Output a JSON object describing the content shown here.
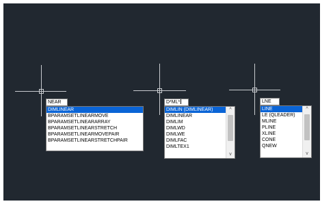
{
  "panels": [
    {
      "input_value": "NEAR",
      "show_caret": false,
      "items": [
        {
          "label": "DIMLINEAR",
          "selected": true
        },
        {
          "label": "BPARAMSETLINEARMOVE",
          "selected": false
        },
        {
          "label": "BPARAMSETLINEARARRAY",
          "selected": false
        },
        {
          "label": "BPARAMSETLINEARSTRETCH",
          "selected": false
        },
        {
          "label": "BPARAMSETLINEARMOVEPAIR",
          "selected": false
        },
        {
          "label": "BPARAMSETLINEARSTRETCHPAIR",
          "selected": false
        }
      ],
      "scrollbar": false
    },
    {
      "input_value": "D*ML*",
      "show_caret": true,
      "items": [
        {
          "label": "DIMLIN (DIMLINEAR)",
          "selected": true
        },
        {
          "label": "DIMLINEAR",
          "selected": false
        },
        {
          "label": "DIMLIM",
          "selected": false
        },
        {
          "label": "DIMLWD",
          "selected": false
        },
        {
          "label": "DIMLWE",
          "selected": false
        },
        {
          "label": "DIMLFAC",
          "selected": false
        },
        {
          "label": "DIMLTEX1",
          "selected": false
        }
      ],
      "scrollbar": true,
      "scroll_up_glyph": "^",
      "scroll_down_glyph": "v"
    },
    {
      "input_value": "LNE",
      "show_caret": false,
      "items": [
        {
          "label": "LINE",
          "selected": true
        },
        {
          "label": "LE (QLEADER)",
          "selected": false
        },
        {
          "label": "MLINE",
          "selected": false
        },
        {
          "label": "PLINE",
          "selected": false
        },
        {
          "label": "XLINE",
          "selected": false
        },
        {
          "label": "CONE",
          "selected": false
        },
        {
          "label": "QNEW",
          "selected": false
        }
      ],
      "scrollbar": true,
      "scroll_up_glyph": "^",
      "scroll_down_glyph": "v"
    }
  ]
}
